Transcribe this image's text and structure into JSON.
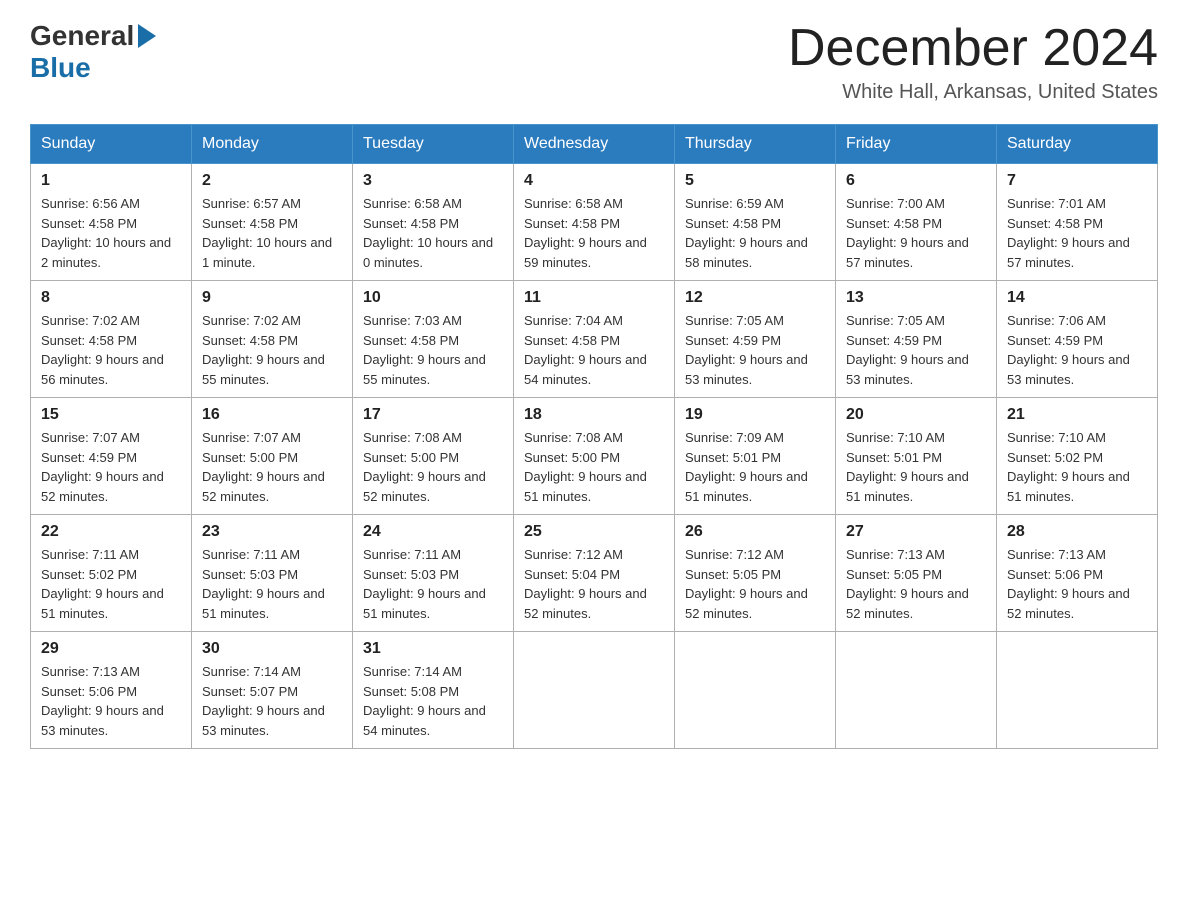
{
  "header": {
    "logo_general": "General",
    "logo_blue": "Blue",
    "month_title": "December 2024",
    "location": "White Hall, Arkansas, United States"
  },
  "days_of_week": [
    "Sunday",
    "Monday",
    "Tuesday",
    "Wednesday",
    "Thursday",
    "Friday",
    "Saturday"
  ],
  "weeks": [
    [
      {
        "day": "1",
        "sunrise": "Sunrise: 6:56 AM",
        "sunset": "Sunset: 4:58 PM",
        "daylight": "Daylight: 10 hours and 2 minutes."
      },
      {
        "day": "2",
        "sunrise": "Sunrise: 6:57 AM",
        "sunset": "Sunset: 4:58 PM",
        "daylight": "Daylight: 10 hours and 1 minute."
      },
      {
        "day": "3",
        "sunrise": "Sunrise: 6:58 AM",
        "sunset": "Sunset: 4:58 PM",
        "daylight": "Daylight: 10 hours and 0 minutes."
      },
      {
        "day": "4",
        "sunrise": "Sunrise: 6:58 AM",
        "sunset": "Sunset: 4:58 PM",
        "daylight": "Daylight: 9 hours and 59 minutes."
      },
      {
        "day": "5",
        "sunrise": "Sunrise: 6:59 AM",
        "sunset": "Sunset: 4:58 PM",
        "daylight": "Daylight: 9 hours and 58 minutes."
      },
      {
        "day": "6",
        "sunrise": "Sunrise: 7:00 AM",
        "sunset": "Sunset: 4:58 PM",
        "daylight": "Daylight: 9 hours and 57 minutes."
      },
      {
        "day": "7",
        "sunrise": "Sunrise: 7:01 AM",
        "sunset": "Sunset: 4:58 PM",
        "daylight": "Daylight: 9 hours and 57 minutes."
      }
    ],
    [
      {
        "day": "8",
        "sunrise": "Sunrise: 7:02 AM",
        "sunset": "Sunset: 4:58 PM",
        "daylight": "Daylight: 9 hours and 56 minutes."
      },
      {
        "day": "9",
        "sunrise": "Sunrise: 7:02 AM",
        "sunset": "Sunset: 4:58 PM",
        "daylight": "Daylight: 9 hours and 55 minutes."
      },
      {
        "day": "10",
        "sunrise": "Sunrise: 7:03 AM",
        "sunset": "Sunset: 4:58 PM",
        "daylight": "Daylight: 9 hours and 55 minutes."
      },
      {
        "day": "11",
        "sunrise": "Sunrise: 7:04 AM",
        "sunset": "Sunset: 4:58 PM",
        "daylight": "Daylight: 9 hours and 54 minutes."
      },
      {
        "day": "12",
        "sunrise": "Sunrise: 7:05 AM",
        "sunset": "Sunset: 4:59 PM",
        "daylight": "Daylight: 9 hours and 53 minutes."
      },
      {
        "day": "13",
        "sunrise": "Sunrise: 7:05 AM",
        "sunset": "Sunset: 4:59 PM",
        "daylight": "Daylight: 9 hours and 53 minutes."
      },
      {
        "day": "14",
        "sunrise": "Sunrise: 7:06 AM",
        "sunset": "Sunset: 4:59 PM",
        "daylight": "Daylight: 9 hours and 53 minutes."
      }
    ],
    [
      {
        "day": "15",
        "sunrise": "Sunrise: 7:07 AM",
        "sunset": "Sunset: 4:59 PM",
        "daylight": "Daylight: 9 hours and 52 minutes."
      },
      {
        "day": "16",
        "sunrise": "Sunrise: 7:07 AM",
        "sunset": "Sunset: 5:00 PM",
        "daylight": "Daylight: 9 hours and 52 minutes."
      },
      {
        "day": "17",
        "sunrise": "Sunrise: 7:08 AM",
        "sunset": "Sunset: 5:00 PM",
        "daylight": "Daylight: 9 hours and 52 minutes."
      },
      {
        "day": "18",
        "sunrise": "Sunrise: 7:08 AM",
        "sunset": "Sunset: 5:00 PM",
        "daylight": "Daylight: 9 hours and 51 minutes."
      },
      {
        "day": "19",
        "sunrise": "Sunrise: 7:09 AM",
        "sunset": "Sunset: 5:01 PM",
        "daylight": "Daylight: 9 hours and 51 minutes."
      },
      {
        "day": "20",
        "sunrise": "Sunrise: 7:10 AM",
        "sunset": "Sunset: 5:01 PM",
        "daylight": "Daylight: 9 hours and 51 minutes."
      },
      {
        "day": "21",
        "sunrise": "Sunrise: 7:10 AM",
        "sunset": "Sunset: 5:02 PM",
        "daylight": "Daylight: 9 hours and 51 minutes."
      }
    ],
    [
      {
        "day": "22",
        "sunrise": "Sunrise: 7:11 AM",
        "sunset": "Sunset: 5:02 PM",
        "daylight": "Daylight: 9 hours and 51 minutes."
      },
      {
        "day": "23",
        "sunrise": "Sunrise: 7:11 AM",
        "sunset": "Sunset: 5:03 PM",
        "daylight": "Daylight: 9 hours and 51 minutes."
      },
      {
        "day": "24",
        "sunrise": "Sunrise: 7:11 AM",
        "sunset": "Sunset: 5:03 PM",
        "daylight": "Daylight: 9 hours and 51 minutes."
      },
      {
        "day": "25",
        "sunrise": "Sunrise: 7:12 AM",
        "sunset": "Sunset: 5:04 PM",
        "daylight": "Daylight: 9 hours and 52 minutes."
      },
      {
        "day": "26",
        "sunrise": "Sunrise: 7:12 AM",
        "sunset": "Sunset: 5:05 PM",
        "daylight": "Daylight: 9 hours and 52 minutes."
      },
      {
        "day": "27",
        "sunrise": "Sunrise: 7:13 AM",
        "sunset": "Sunset: 5:05 PM",
        "daylight": "Daylight: 9 hours and 52 minutes."
      },
      {
        "day": "28",
        "sunrise": "Sunrise: 7:13 AM",
        "sunset": "Sunset: 5:06 PM",
        "daylight": "Daylight: 9 hours and 52 minutes."
      }
    ],
    [
      {
        "day": "29",
        "sunrise": "Sunrise: 7:13 AM",
        "sunset": "Sunset: 5:06 PM",
        "daylight": "Daylight: 9 hours and 53 minutes."
      },
      {
        "day": "30",
        "sunrise": "Sunrise: 7:14 AM",
        "sunset": "Sunset: 5:07 PM",
        "daylight": "Daylight: 9 hours and 53 minutes."
      },
      {
        "day": "31",
        "sunrise": "Sunrise: 7:14 AM",
        "sunset": "Sunset: 5:08 PM",
        "daylight": "Daylight: 9 hours and 54 minutes."
      },
      null,
      null,
      null,
      null
    ]
  ]
}
